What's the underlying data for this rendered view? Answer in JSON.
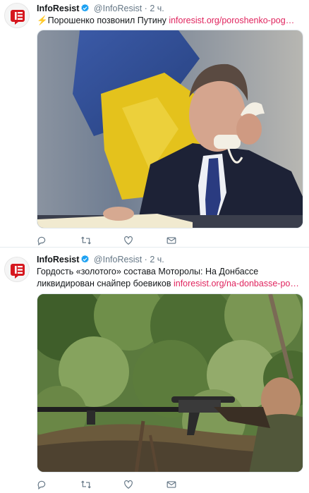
{
  "tweets": [
    {
      "name": "InfoResist",
      "handle": "@InfoResist",
      "separator": " · ",
      "time": "2 ч.",
      "lead_emoji": "⚡",
      "text": "Порошенко позвонил Путину ",
      "link": "inforesist.org/poroshenko-pog…",
      "image_subject": "man-on-telephone-photo"
    },
    {
      "name": "InfoResist",
      "handle": "@InfoResist",
      "separator": " · ",
      "time": "2 ч.",
      "text": "Гордость «золотого» состава Моторолы: На Донбассе ликвидирован снайпер боевиков ",
      "link": "inforesist.org/na-donbasse-po…",
      "image_subject": "sniper-in-bushes-photo"
    }
  ],
  "colors": {
    "link": "#e0245e",
    "verified": "#1da1f2",
    "logo_red": "#d6171e",
    "icon_gray": "#657786",
    "divider": "#e6ecf0"
  },
  "icons": [
    "reply-icon",
    "retweet-icon",
    "like-icon",
    "direct-message-icon",
    "verified-badge-icon"
  ]
}
